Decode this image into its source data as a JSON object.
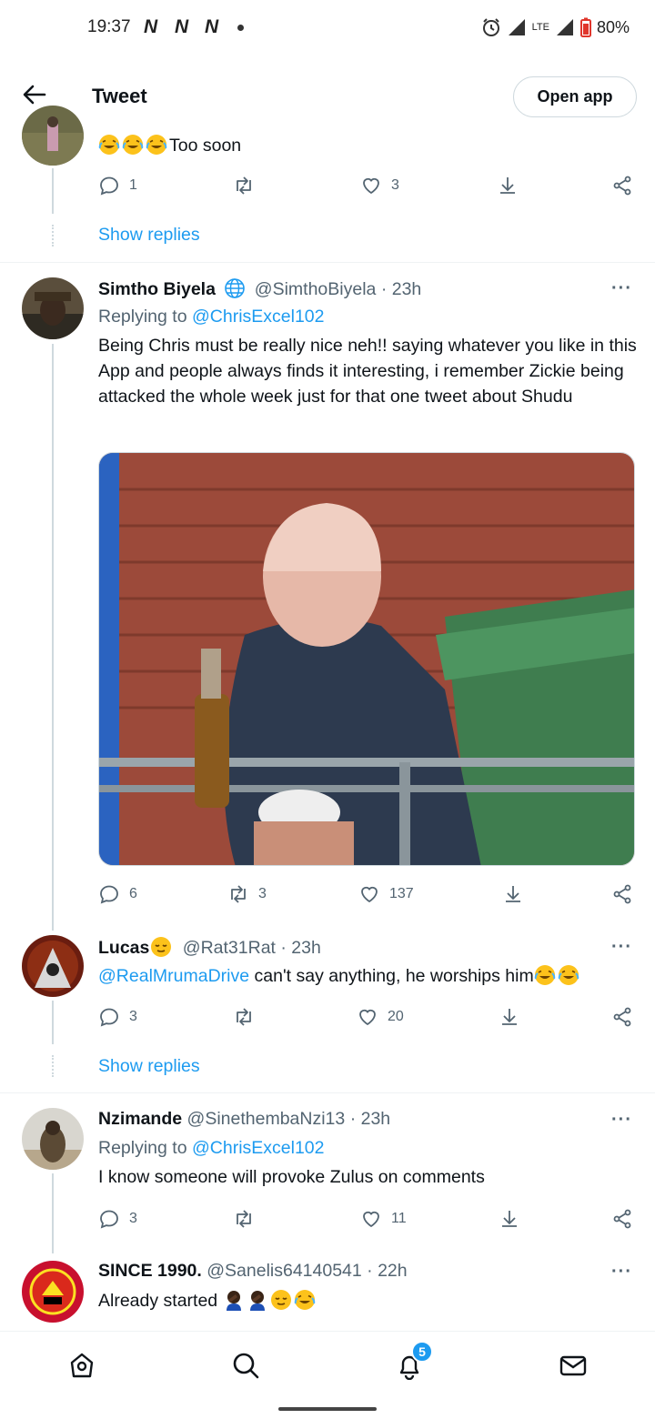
{
  "status_bar": {
    "time": "19:37",
    "carrier_icons": [
      "N",
      "N",
      "N"
    ],
    "network": "LTE",
    "battery": "80%"
  },
  "header": {
    "title": "Tweet",
    "open_app_label": "Open app"
  },
  "tweets": [
    {
      "text": "Too soon",
      "emoji": [
        "joy-emoji",
        "joy-emoji",
        "joy-emoji"
      ],
      "replies": "1",
      "retweets": "",
      "likes": "3",
      "show_replies": "Show replies"
    },
    {
      "name": "Simtho Biyela",
      "handle": "@SimthoBiyela",
      "time": "· 23h",
      "replying_prefix": "Replying to",
      "replying_to": "@ChrisExcel102",
      "text": "Being Chris must be really nice neh!! saying whatever you like in this App and people always finds it interesting, i remember Zickie being attacked the whole week just for that one tweet about Shudu",
      "replies": "6",
      "retweets": "3",
      "likes": "137"
    },
    {
      "name": "Lucas",
      "handle": "@Rat31Rat",
      "time": "· 23h",
      "mention": "@RealMrumaDrive",
      "text": "can't say anything, he worships him",
      "replies": "3",
      "retweets": "",
      "likes": "20",
      "show_replies": "Show replies"
    },
    {
      "name": "Nzimande",
      "handle": "@SinethembaNzi13",
      "time": "· 23h",
      "replying_prefix": "Replying to",
      "replying_to": "@ChrisExcel102",
      "text": "I know someone will provoke Zulus on comments",
      "replies": "3",
      "retweets": "",
      "likes": "11"
    },
    {
      "name": "SINCE 1990.",
      "handle": "@Sanelis64140541",
      "time": "· 22h",
      "text": "Already started"
    }
  ],
  "bottom_nav": {
    "notifications_badge": "5"
  },
  "colors": {
    "accent": "#1d9bf0",
    "text": "#0f1419",
    "secondary": "#536471"
  }
}
